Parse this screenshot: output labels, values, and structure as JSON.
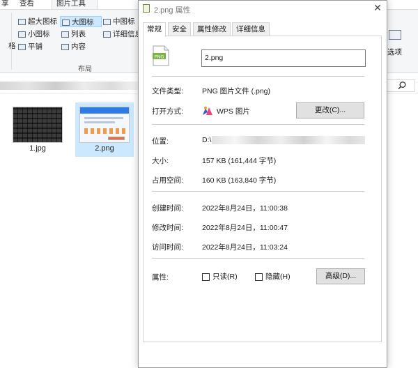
{
  "explorer": {
    "tabs": [
      {
        "label": "享"
      },
      {
        "label": "查看"
      },
      {
        "label": "图片工具"
      }
    ],
    "layout_options": [
      {
        "label": "超大图标"
      },
      {
        "label": "大图标"
      },
      {
        "label": "中图标"
      },
      {
        "label": "小图标"
      },
      {
        "label": "列表"
      },
      {
        "label": "详细信息"
      },
      {
        "label": "平铺"
      },
      {
        "label": "内容"
      }
    ],
    "left_cut_label": "格",
    "right_cut_label": "选项",
    "layout_group_label": "布局",
    "files": [
      {
        "name": "1.jpg"
      },
      {
        "name": "2.png"
      }
    ]
  },
  "dialog": {
    "title": "2.png 属性",
    "close_label": "✕",
    "tabs": [
      {
        "label": "常规"
      },
      {
        "label": "安全"
      },
      {
        "label": "属性修改"
      },
      {
        "label": "详细信息"
      }
    ],
    "icon_label": "PNG",
    "file_name": "2.png",
    "rows": {
      "type": {
        "label": "文件类型:",
        "value": "PNG 图片文件 (.png)"
      },
      "open_with": {
        "label": "打开方式:",
        "value": "WPS 图片",
        "button": "更改(C)..."
      },
      "location": {
        "label": "位置:",
        "value": "D:\\"
      },
      "size": {
        "label": "大小:",
        "value": "157 KB (161,444 字节)"
      },
      "size_on_disk": {
        "label": "占用空间:",
        "value": "160 KB (163,840 字节)"
      },
      "created": {
        "label": "创建时间:",
        "value": "2022年8月24日，11:00:38"
      },
      "modified": {
        "label": "修改时间:",
        "value": "2022年8月24日，11:00:47"
      },
      "accessed": {
        "label": "访问时间:",
        "value": "2022年8月24日，11:03:24"
      },
      "attributes": {
        "label": "属性:",
        "readonly": "只读(R)",
        "hidden": "隐藏(H)",
        "advanced_button": "高级(D)..."
      }
    },
    "colors": {
      "wps_blue": "#3b5bdb",
      "wps_pink": "#e8467c",
      "wps_orange": "#f59f00"
    }
  }
}
